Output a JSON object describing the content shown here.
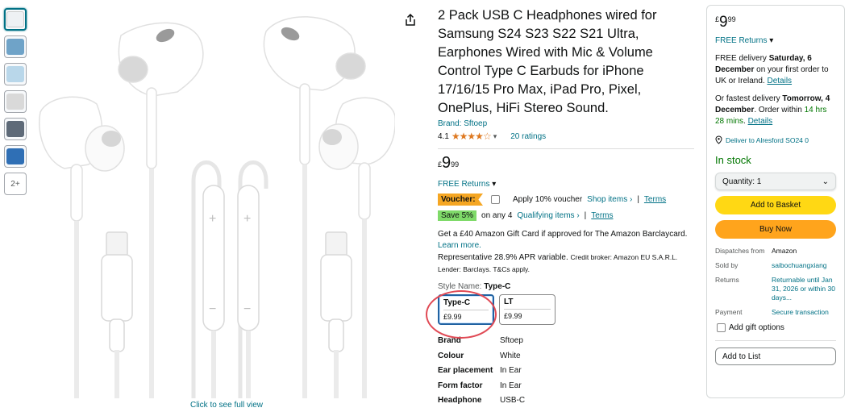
{
  "gallery": {
    "thumbnails": [
      "thumb-1",
      "thumb-2",
      "thumb-3",
      "thumb-4",
      "thumb-5",
      "thumb-6"
    ],
    "more_label": "2+",
    "full_view_label": "Click to see full view"
  },
  "product": {
    "title": "2 Pack USB C Headphones wired for Samsung S24 S23 S22 S21 Ultra, Earphones Wired with Mic & Volume Control Type C Earbuds for iPhone 17/16/15 Pro Max, iPad Pro, Pixel, OnePlus, HiFi Stereo Sound.",
    "brand": "Brand: Sftoep",
    "rating": "4.1",
    "stars": "★★★★☆",
    "ratings_count": "20 ratings",
    "price_currency": "£",
    "price_whole": "9",
    "price_fraction": "99",
    "free_returns": "FREE Returns",
    "voucher_badge": "Voucher:",
    "voucher_text": "Apply 10% voucher",
    "shop_items": "Shop items ›",
    "terms": "Terms",
    "save_badge": "Save 5%",
    "save_text": "on any 4",
    "qualifying": "Qualifying items ›",
    "gift_card_line1": "Get a £40 Amazon Gift Card if approved for The Amazon Barclaycard.",
    "learn_more": "Learn more.",
    "apr_text": "Representative 28.9% APR variable.",
    "apr_small": "Credit broker: Amazon EU S.A.R.L. Lender: Barclays. T&Cs apply.",
    "style_label": "Style Name:",
    "style_value": "Type-C",
    "styles": [
      {
        "name": "Type-C",
        "price": "£9.99"
      },
      {
        "name": "LT",
        "price": "£9.99"
      }
    ],
    "specs": [
      {
        "k": "Brand",
        "v": "Sftoep"
      },
      {
        "k": "Colour",
        "v": "White"
      },
      {
        "k": "Ear placement",
        "v": "In Ear"
      },
      {
        "k": "Form factor",
        "v": "In Ear"
      },
      {
        "k": "Headphone",
        "v": "USB-C"
      }
    ]
  },
  "buybox": {
    "price_currency": "£",
    "price_whole": "9",
    "price_fraction": "99",
    "free_returns": "FREE Returns",
    "delivery_prefix": "FREE delivery",
    "delivery_date": "Saturday, 6 December",
    "delivery_suffix": "on your first order to UK or Ireland.",
    "details": "Details",
    "fastest_prefix": "Or fastest delivery",
    "fastest_date": "Tomorrow, 4 December",
    "order_within": ". Order within",
    "countdown": "14 hrs 28 mins",
    "deliver_to": "Deliver to Alresford SO24 0",
    "stock": "In stock",
    "quantity": "Quantity: 1",
    "add_to_basket": "Add to Basket",
    "buy_now": "Buy Now",
    "meta": [
      {
        "k": "Dispatches from",
        "v": "Amazon"
      },
      {
        "k": "Sold by",
        "v": "saibochuangxiang"
      },
      {
        "k": "Returns",
        "v": "Returnable until Jan 31, 2026 or within 30 days..."
      },
      {
        "k": "Payment",
        "v": "Secure transaction"
      }
    ],
    "gift_options": "Add gift options",
    "add_to_list": "Add to List"
  },
  "colors": {
    "link": "#007185",
    "star": "#de7921",
    "add_to_basket": "#ffd814",
    "buy_now": "#ffa41c",
    "in_stock": "#007600",
    "voucher": "#f5a623",
    "save": "#7fda69",
    "annotation_circle": "#e04a55"
  }
}
